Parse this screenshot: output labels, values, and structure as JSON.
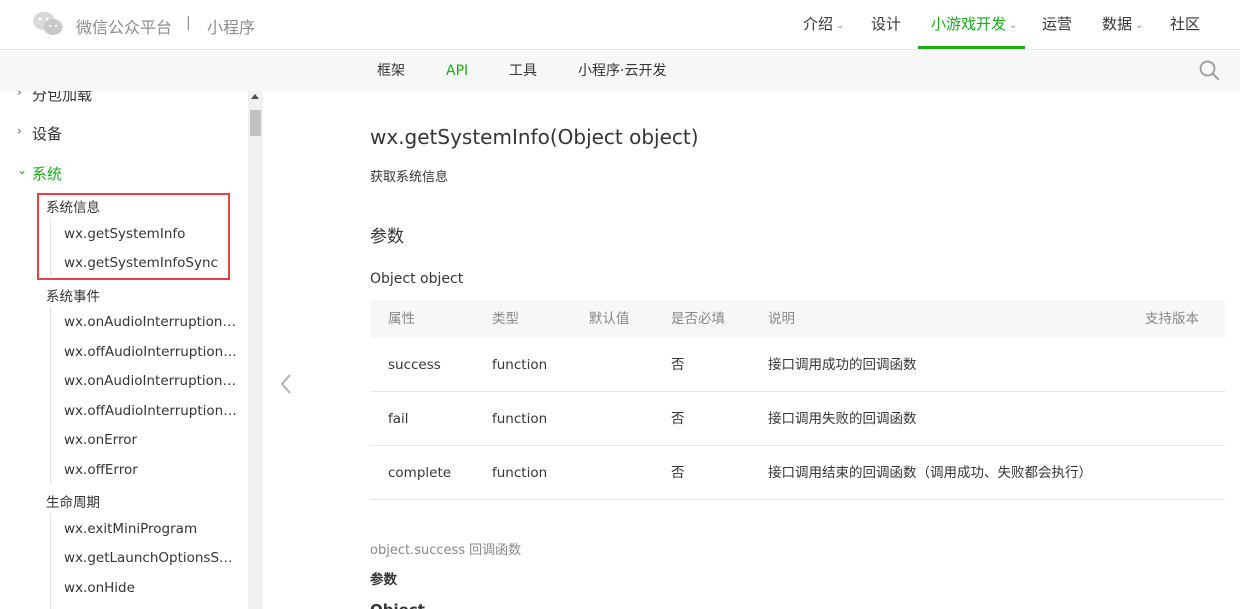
{
  "header": {
    "brand": "微信公众平台",
    "separator": "|",
    "subtitle": "小程序",
    "nav": [
      {
        "label": "介绍",
        "dropdown": true,
        "active": false
      },
      {
        "label": "设计",
        "dropdown": false,
        "active": false
      },
      {
        "label": "小游戏开发",
        "dropdown": true,
        "active": true
      },
      {
        "label": "运营",
        "dropdown": false,
        "active": false
      },
      {
        "label": "数据",
        "dropdown": true,
        "active": false
      },
      {
        "label": "社区",
        "dropdown": false,
        "active": false
      }
    ]
  },
  "subnav": {
    "items": [
      {
        "label": "框架",
        "active": false
      },
      {
        "label": "API",
        "active": true
      },
      {
        "label": "工具",
        "active": false
      },
      {
        "label": "小程序·云开发",
        "active": false
      }
    ],
    "search_icon": "search-icon"
  },
  "sidebar": {
    "top_items": [
      "分包加载",
      "设备",
      "系统"
    ],
    "groups": [
      {
        "label": "系统信息",
        "leaves": [
          "wx.getSystemInfo",
          "wx.getSystemInfoSync"
        ]
      },
      {
        "label": "系统事件",
        "leaves": [
          "wx.onAudioInterruptionBegin",
          "wx.offAudioInterruptionBegin",
          "wx.onAudioInterruptionEnd",
          "wx.offAudioInterruptionEnd",
          "wx.onError",
          "wx.offError"
        ]
      },
      {
        "label": "生命周期",
        "leaves": [
          "wx.exitMiniProgram",
          "wx.getLaunchOptionsSync",
          "wx.onHide"
        ]
      }
    ]
  },
  "content": {
    "title": "wx.getSystemInfo(Object object)",
    "description": "获取系统信息",
    "params_heading": "参数",
    "object_label": "Object object",
    "table": {
      "headers": [
        "属性",
        "类型",
        "默认值",
        "是否必填",
        "说明",
        "支持版本"
      ],
      "rows": [
        [
          "success",
          "function",
          "",
          "否",
          "接口调用成功的回调函数",
          ""
        ],
        [
          "fail",
          "function",
          "",
          "否",
          "接口调用失败的回调函数",
          ""
        ],
        [
          "complete",
          "function",
          "",
          "否",
          "接口调用结束的回调函数（调用成功、失败都会执行）",
          ""
        ]
      ]
    },
    "callback_label": "object.success 回调函数",
    "callback_params_heading": "参数",
    "next_label": "Object"
  },
  "colors": {
    "accent": "#1aad19",
    "highlight": "#e64340"
  }
}
